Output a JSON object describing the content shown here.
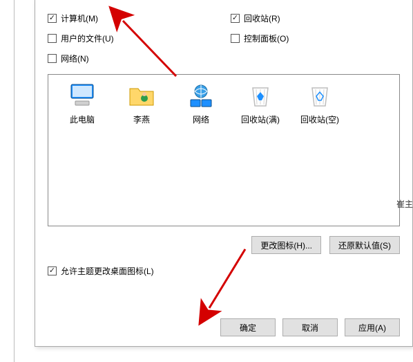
{
  "checkboxes": {
    "computer": {
      "label": "计算机(M)",
      "checked": true
    },
    "recycle": {
      "label": "回收站(R)",
      "checked": true
    },
    "userfiles": {
      "label": "用户的文件(U)",
      "checked": false
    },
    "control": {
      "label": "控制面板(O)",
      "checked": false
    },
    "network": {
      "label": "网络(N)",
      "checked": false
    }
  },
  "icons": [
    {
      "name": "pc-icon",
      "label": "此电脑"
    },
    {
      "name": "user-icon",
      "label": "李燕"
    },
    {
      "name": "network-icon",
      "label": "网络"
    },
    {
      "name": "bin-full-icon",
      "label": "回收站(满)"
    },
    {
      "name": "bin-empty-icon",
      "label": "回收站(空)"
    }
  ],
  "buttons": {
    "change_icon": "更改图标(H)...",
    "restore_default": "还原默认值(S)",
    "ok": "确定",
    "cancel": "取消",
    "apply": "应用(A)"
  },
  "allow_theme": {
    "label": "允许主题更改桌面图标(L)",
    "checked": true
  },
  "side_snippet": "崔主"
}
